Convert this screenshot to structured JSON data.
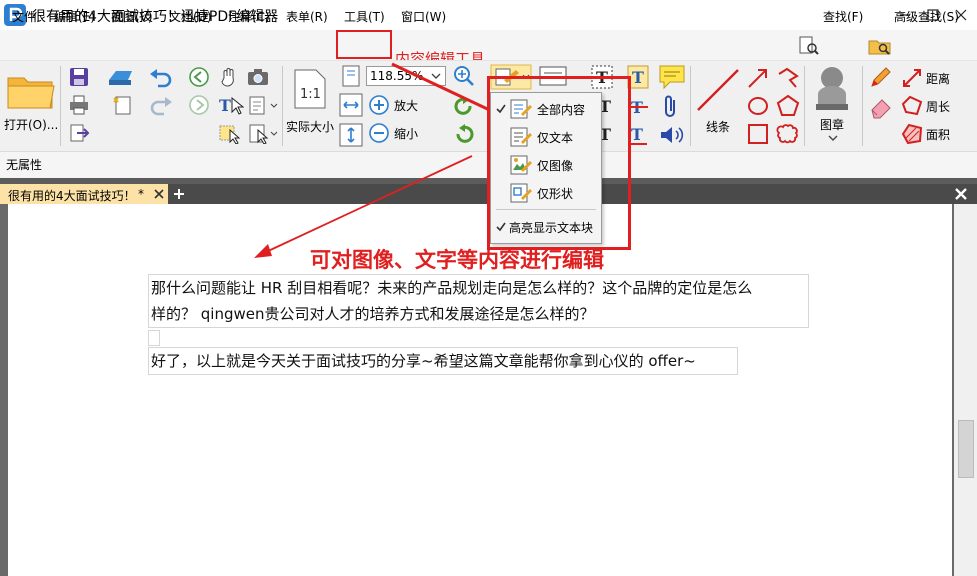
{
  "window": {
    "title": "很有用的4大面试技巧！迅捷PDF编辑器"
  },
  "menu": [
    "文件",
    "编辑(E)",
    "视图(V)",
    "文档(D)",
    "注释(C)",
    "表单(R)",
    "工具(T)",
    "窗口(W)"
  ],
  "search": {
    "find_label": "查找(F)",
    "advanced_label": "高级查找(S)"
  },
  "ribbon": {
    "open_label": "打开(O)...",
    "actual_size_label": "实际大小",
    "zoom_value": "118.55%",
    "zoom_in_label": "放大",
    "zoom_out_label": "缩小",
    "line_label": "线条",
    "stamp_label": "图章",
    "distance_label": "距离",
    "perimeter_label": "周长",
    "area_label": "面积"
  },
  "properties": {
    "label": "无属性"
  },
  "tabs": [
    {
      "label": "很有用的4大面试技巧！",
      "modified": "*"
    }
  ],
  "dropdown": {
    "items": [
      {
        "label": "全部内容",
        "checked": true
      },
      {
        "label": "仅文本",
        "checked": false
      },
      {
        "label": "仅图像",
        "checked": false
      },
      {
        "label": "仅形状",
        "checked": false
      }
    ],
    "highlight_item": {
      "label": "高亮显示文本块",
      "checked": true
    }
  },
  "annotations": {
    "tool_label": "内容编辑工具",
    "edit_caption": "可对图像、文字等内容进行编辑"
  },
  "document": {
    "paragraph1_line1": "那什么问题能让 HR 刮目相看呢？未来的产品规划走向是怎么样的？这个品牌的定位是怎么",
    "paragraph1_line2": "样的？  qingwen贵公司对人才的培养方式和发展途径是怎么样的？",
    "paragraph2": "好了，以上就是今天关于面试技巧的分享~希望这篇文章能帮你拿到心仪的 offer~"
  },
  "colors": {
    "accent_red": "#e02020",
    "tab_yellow": "#fce2a6",
    "logo_blue": "#2f7fd0"
  }
}
